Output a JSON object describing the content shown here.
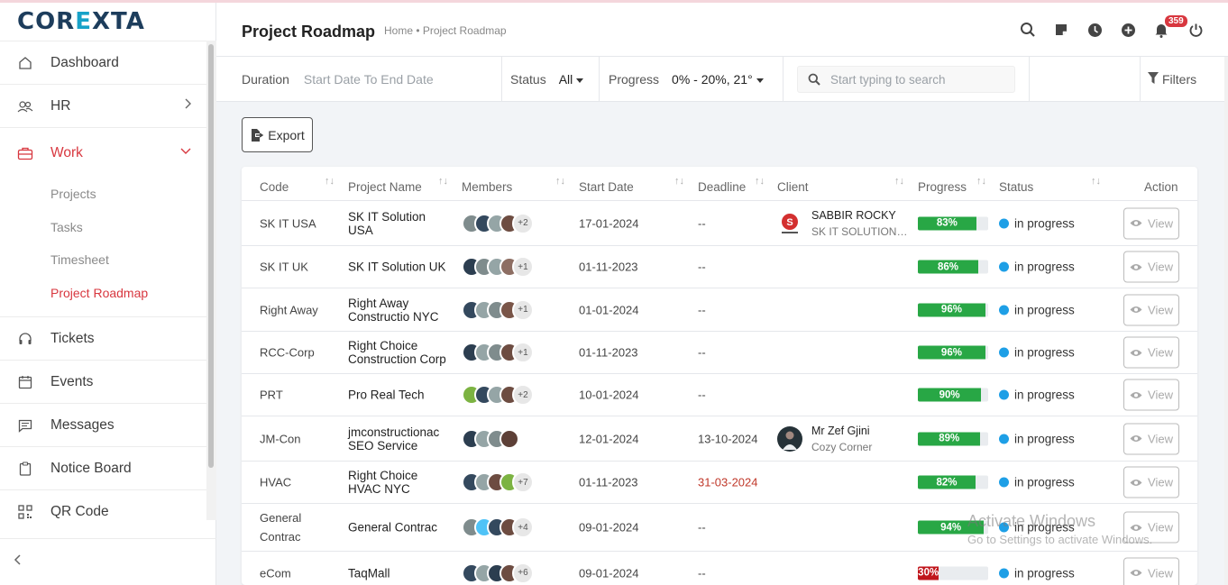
{
  "brand": {
    "logo_text_1": "COR",
    "logo_text_2": "E",
    "logo_text_3": "XTA"
  },
  "sidebar": {
    "items": [
      {
        "label": "Dashboard"
      },
      {
        "label": "HR"
      },
      {
        "label": "Work"
      },
      {
        "label": "Tickets"
      },
      {
        "label": "Events"
      },
      {
        "label": "Messages"
      },
      {
        "label": "Notice Board"
      },
      {
        "label": "QR Code"
      }
    ],
    "work_sub": [
      {
        "label": "Projects"
      },
      {
        "label": "Tasks"
      },
      {
        "label": "Timesheet"
      },
      {
        "label": "Project Roadmap"
      }
    ]
  },
  "header": {
    "title": "Project Roadmap",
    "breadcrumb": "Home • Project Roadmap",
    "notification_count": "359"
  },
  "filters": {
    "duration_label": "Duration",
    "duration_placeholder": "Start Date To End Date",
    "status_label": "Status",
    "status_value": "All",
    "progress_label": "Progress",
    "progress_value": "0% - 20%, 21°",
    "search_placeholder": "Start typing to search",
    "filters_label": "Filters"
  },
  "toolbar": {
    "export_label": "Export"
  },
  "table": {
    "headers": [
      "Code",
      "Project Name",
      "Members",
      "Start Date",
      "Deadline",
      "Client",
      "Progress",
      "Status",
      "Action"
    ],
    "view_label": "View",
    "rows": [
      {
        "code": "SK IT USA",
        "name": "SK IT Solution USA",
        "more": "+2",
        "start": "17-01-2024",
        "deadline": "--",
        "client_name": "SABBIR ROCKY",
        "client_company": "SK IT SOLUTION USA",
        "progress": 83,
        "progress_label": "83%",
        "status": "in progress"
      },
      {
        "code": "SK IT UK",
        "name": "SK IT Solution UK",
        "more": "+1",
        "start": "01-11-2023",
        "deadline": "--",
        "client_name": "",
        "client_company": "",
        "progress": 86,
        "progress_label": "86%",
        "status": "in progress"
      },
      {
        "code": "Right Away",
        "name": "Right Away Constructio NYC",
        "more": "+1",
        "start": "01-01-2024",
        "deadline": "--",
        "client_name": "",
        "client_company": "",
        "progress": 96,
        "progress_label": "96%",
        "status": "in progress"
      },
      {
        "code": "RCC-Corp",
        "name": "Right Choice Construction Corp",
        "more": "+1",
        "start": "01-11-2023",
        "deadline": "--",
        "client_name": "",
        "client_company": "",
        "progress": 96,
        "progress_label": "96%",
        "status": "in progress"
      },
      {
        "code": "PRT",
        "name": "Pro Real Tech",
        "more": "+2",
        "start": "10-01-2024",
        "deadline": "--",
        "client_name": "",
        "client_company": "",
        "progress": 90,
        "progress_label": "90%",
        "status": "in progress"
      },
      {
        "code": "JM-Con",
        "name": "jmconstructionac SEO Service",
        "more": "",
        "start": "12-01-2024",
        "deadline": "13-10-2024",
        "client_name": "Mr Zef Gjini",
        "client_company": "Cozy Corner",
        "progress": 89,
        "progress_label": "89%",
        "status": "in progress"
      },
      {
        "code": "HVAC",
        "name": "Right Choice HVAC NYC",
        "more": "+7",
        "start": "01-11-2023",
        "deadline": "31-03-2024",
        "client_name": "",
        "client_company": "",
        "progress": 82,
        "progress_label": "82%",
        "status": "in progress"
      },
      {
        "code": "General Contrac",
        "name": "General Contrac",
        "more": "+4",
        "start": "09-01-2024",
        "deadline": "--",
        "client_name": "",
        "client_company": "",
        "progress": 94,
        "progress_label": "94%",
        "status": "in progress"
      },
      {
        "code": "eCom",
        "name": "TaqMall",
        "more": "+6",
        "start": "09-01-2024",
        "deadline": "--",
        "client_name": "",
        "client_company": "",
        "progress": 30,
        "progress_label": "30%",
        "status": "in progress"
      }
    ]
  },
  "colors": {
    "accent": "#d8373f",
    "progress_good": "#28a745",
    "progress_low": "#c0161c",
    "status_dot": "#1e9fe6"
  },
  "watermark": {
    "line1": "Activate Windows",
    "line2": "Go to Settings to activate Windows."
  }
}
